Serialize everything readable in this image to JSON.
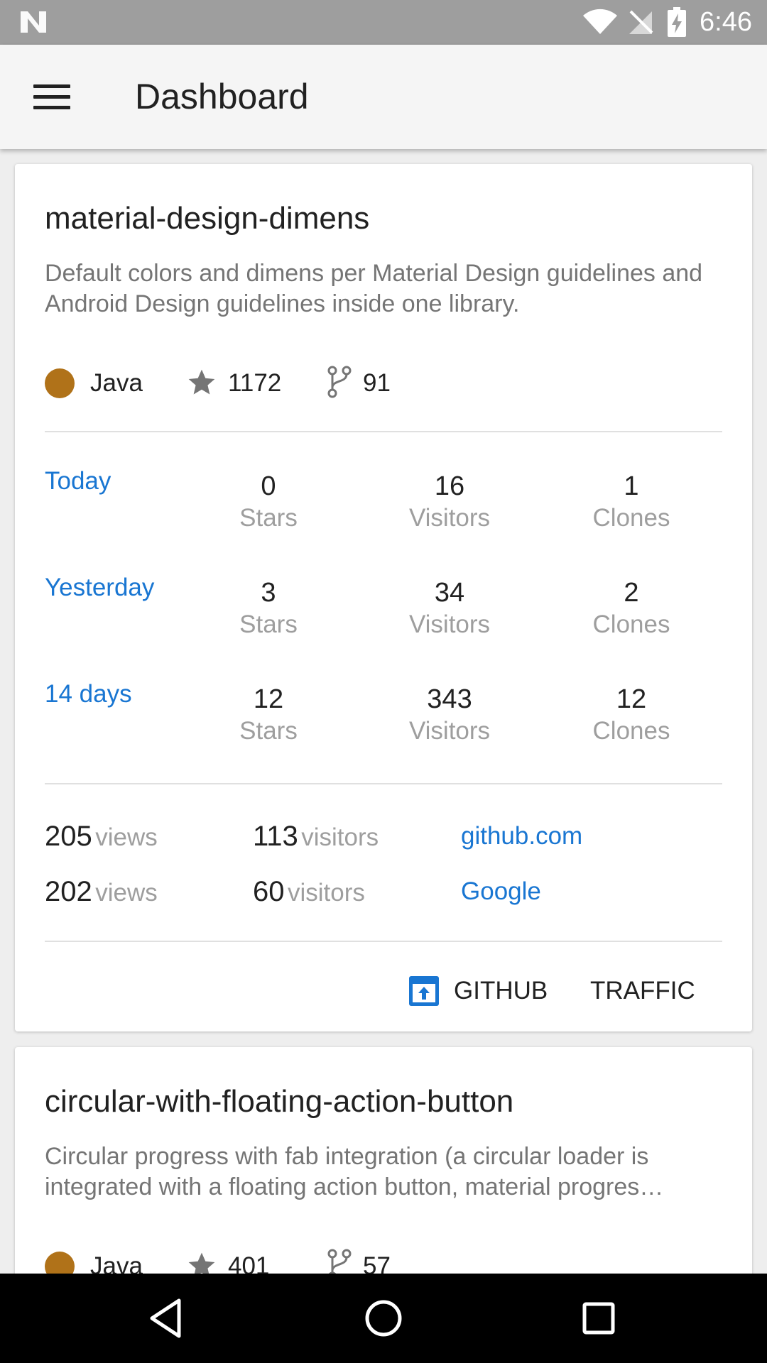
{
  "status_bar": {
    "time": "6:46"
  },
  "app_bar": {
    "title": "Dashboard"
  },
  "repos": [
    {
      "name": "material-design-dimens",
      "description": "Default colors and dimens per Material Design guidelines and Android Design guidelines inside one library.",
      "language": "Java",
      "language_color": "#b07219",
      "stars": "1172",
      "forks": "91",
      "stats": [
        {
          "period": "Today",
          "stars": "0",
          "stars_label": "Stars",
          "visitors": "16",
          "visitors_label": "Visitors",
          "clones": "1",
          "clones_label": "Clones"
        },
        {
          "period": "Yesterday",
          "stars": "3",
          "stars_label": "Stars",
          "visitors": "34",
          "visitors_label": "Visitors",
          "clones": "2",
          "clones_label": "Clones"
        },
        {
          "period": "14 days",
          "stars": "12",
          "stars_label": "Stars",
          "visitors": "343",
          "visitors_label": "Visitors",
          "clones": "12",
          "clones_label": "Clones"
        }
      ],
      "referrers": [
        {
          "views": "205",
          "views_label": "views",
          "visitors": "113",
          "visitors_label": "visitors",
          "source": "github.com"
        },
        {
          "views": "202",
          "views_label": "views",
          "visitors": "60",
          "visitors_label": "visitors",
          "source": "Google"
        }
      ],
      "actions": {
        "github": "GITHUB",
        "traffic": "TRAFFIC"
      }
    },
    {
      "name": "circular-with-floating-action-button",
      "description": "Circular progress with fab integration (a circular loader is integrated with a floating action button, material progres…",
      "language": "Java",
      "stars": "401",
      "forks": "57"
    }
  ],
  "colors": {
    "accent": "#1976d2",
    "status_bar": "#9e9e9e",
    "app_bar": "#f5f5f5"
  }
}
